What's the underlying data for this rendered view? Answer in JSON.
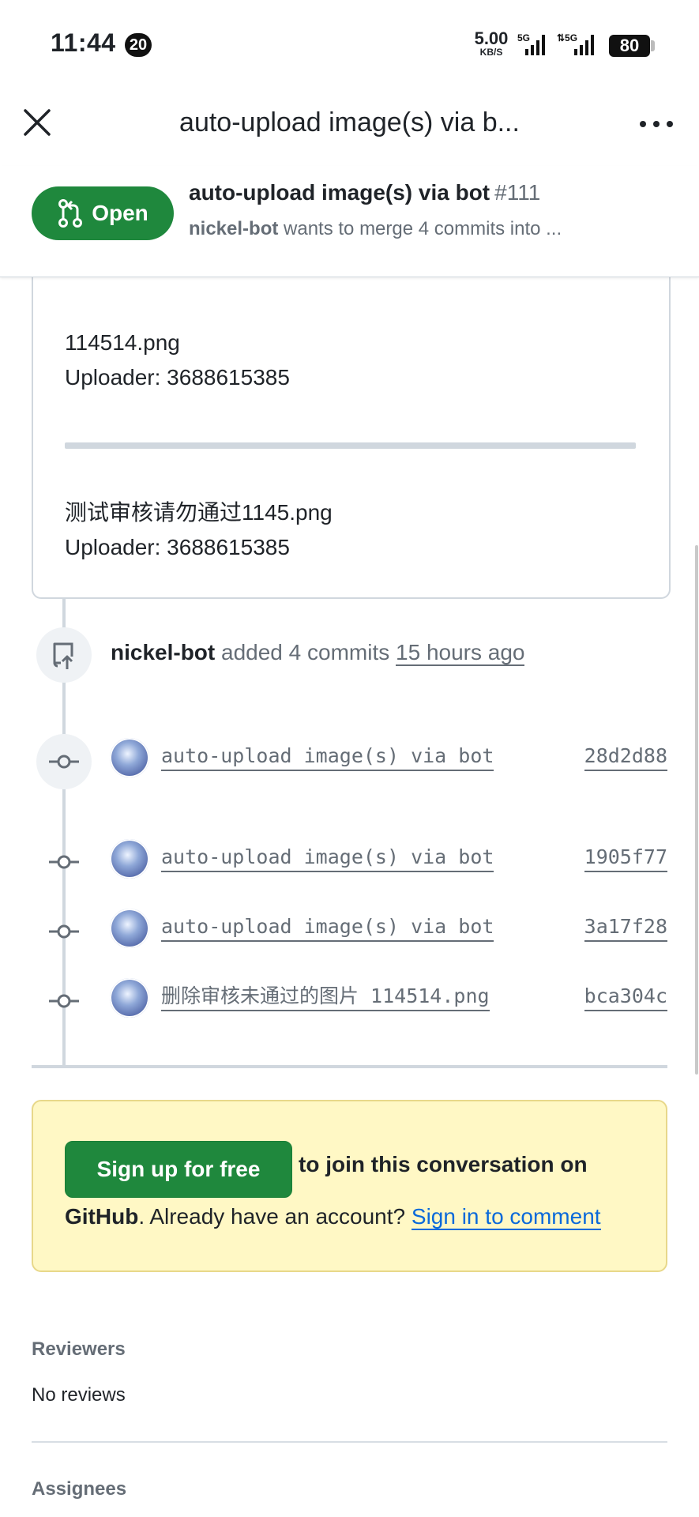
{
  "status_bar": {
    "time": "11:44",
    "notification_count": "20",
    "net_speed_value": "5.00",
    "net_speed_unit": "KB/S",
    "signal1_label": "5G",
    "signal2_label": "5G",
    "battery": "80"
  },
  "app_bar": {
    "title": "auto-upload image(s) via b..."
  },
  "pr_header": {
    "state_label": "Open",
    "title": "auto-upload image(s) via bot",
    "number": "#111",
    "author": "nickel-bot",
    "summary": "wants to merge 4 commits into ..."
  },
  "comment": {
    "entries": [
      {
        "filename": "114514.png",
        "uploader": "Uploader: 3688615385"
      },
      {
        "filename": "测试审核请勿通过1145.png",
        "uploader": "Uploader: 3688615385"
      }
    ]
  },
  "event": {
    "actor": "nickel-bot",
    "action": "added 4 commits",
    "time_ago": "15 hours ago"
  },
  "commits": [
    {
      "message": "auto-upload image(s) via bot",
      "sha": "28d2d88"
    },
    {
      "message": "auto-upload image(s) via bot",
      "sha": "1905f77"
    },
    {
      "message": "auto-upload image(s) via bot",
      "sha": "3a17f28"
    },
    {
      "message": "删除审核未通过的图片 114514.png",
      "sha": "bca304c"
    }
  ],
  "signup": {
    "button_label": "Sign up for free",
    "tail_text": "to join this conversation on",
    "github": "GitHub",
    "middle_text": ". Already have an account?",
    "signin_link": "Sign in to comment"
  },
  "sidebar": {
    "reviewers_heading": "Reviewers",
    "reviewers_value": "No reviews",
    "assignees_heading": "Assignees"
  },
  "colors": {
    "green": "#1f883d",
    "link": "#0969da",
    "notice_bg": "#fff8c5",
    "border": "#d0d7de"
  },
  "icons": [
    "close-icon",
    "more-icon",
    "pull-request-icon",
    "push-icon",
    "git-commit-icon",
    "avatar"
  ]
}
